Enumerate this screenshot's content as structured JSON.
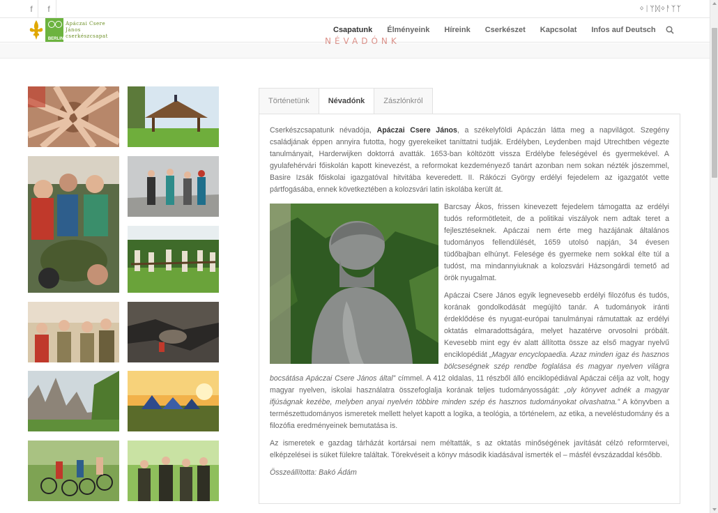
{
  "topbar": {
    "social": [
      "f",
      "f"
    ],
    "script_text": "ᛜᛁᛘᛞᛜᚨᛉᛉ"
  },
  "logo": {
    "line1": "Apáczai Csere János",
    "line2": "cserkészcsapat",
    "badge": "BERLIN"
  },
  "nav": {
    "items": [
      "Csapatunk",
      "Élményeink",
      "Híreink",
      "Cserkészet",
      "Kapcsolat",
      "Infos auf Deutsch"
    ],
    "active": "Csapatunk",
    "ghost_title": "NÉVADÓNK"
  },
  "tabs": [
    "Történetünk",
    "Névadónk",
    "Zászlónkról"
  ],
  "active_tab": "Névadónk",
  "article": {
    "p1_before": "Cserkészcsapatunk névadója, ",
    "p1_bold": "Apáczai Csere János",
    "p1_after": ", a székelyföldi Apáczán látta meg a napvilágot. Szegény családjának éppen annyira futotta, hogy gyerekeiket taníttatni tudják. Erdélyben, Leydenben majd Utrechtben végezte tanulmányait, Harderwijken doktorrá avatták. 1653-ban költözött vissza Erdélybe feleségével és gyermekével. A gyulafehérvári főiskolán kapott kinevezést, a reformokat kezdeményező tanárt azonban nem sokan nézték jószemmel, Basire Izsák főiskolai igazgatóval hitvitába keveredett. II. Rákóczi György erdélyi fejedelem az igazgatót vette pártfogásába, ennek következtében a kolozsvári latin iskolába került át.",
    "p2": "Barcsay Ákos, frissen kinevezett fejedelem támogatta az erdélyi tudós reformötleteit, de a politikai viszályok nem adtak teret a fejlesztéseknek. Apáczai nem érte meg hazájának általános tudományos fellendülését, 1659 utolsó napján, 34 évesen tüdőbajban elhúnyt. Felesége és gyermeke nem sokkal élte túl a tudóst, ma mindannyiuknak a kolozsvári Házsongárdi temető ad örök nyugalmat.",
    "p3_a": "Apáczai Csere János egyik legnevesebb erdélyi filozófus és tudós, korának gondolkodását megújító tanár. A tudományok iránti érdeklődése és nyugat-európai tanulmányai rámutattak az erdélyi oktatás elmaradottságára, melyet hazatérve orvosolni próbált. Kevesebb mint egy év alatt állította össze az első magyar nyelvű enciklopédiát ",
    "p3_italic1": "„Magyar encyclopaedia. Azaz minden igaz és hasznos bölcseségnek szép rendbe foglalása és magyar nyelven világra bocsátása Apáczai Csere János által”",
    "p3_b": " címmel. A 412 oldalas, 11 részből álló enciklopédiával Apáczai célja az volt, hogy magyar nyelven, iskolai használatra összefoglalja korának teljes tudományosságát: ",
    "p3_italic2": "„oly könyvet adnék a magyar ifjúságnak kezébe, melyben anyai nyelvén többire minden szép és hasznos tudományokat olvashatna.”",
    "p3_c": " A könyvben a természettudományos ismeretek mellett helyet kapott a logika, a teológia, a történelem, az etika, a neveléstudomány és a filozófia eredményeinek bemutatása is.",
    "p4": "Az ismeretek e gazdag tárházát kortársai nem méltatták, s az oktatás minőségének javítását célzó reformtervei, elképzelései is süket fülekre találtak. Törekvéseit a könyv második kiadásával ismerték el – másfél évszázaddal később.",
    "credit": "Összeállította: Bakó Ádám"
  },
  "colors": {
    "accent": "#6cb33f",
    "text": "#666666",
    "border": "#e1e1e1"
  }
}
